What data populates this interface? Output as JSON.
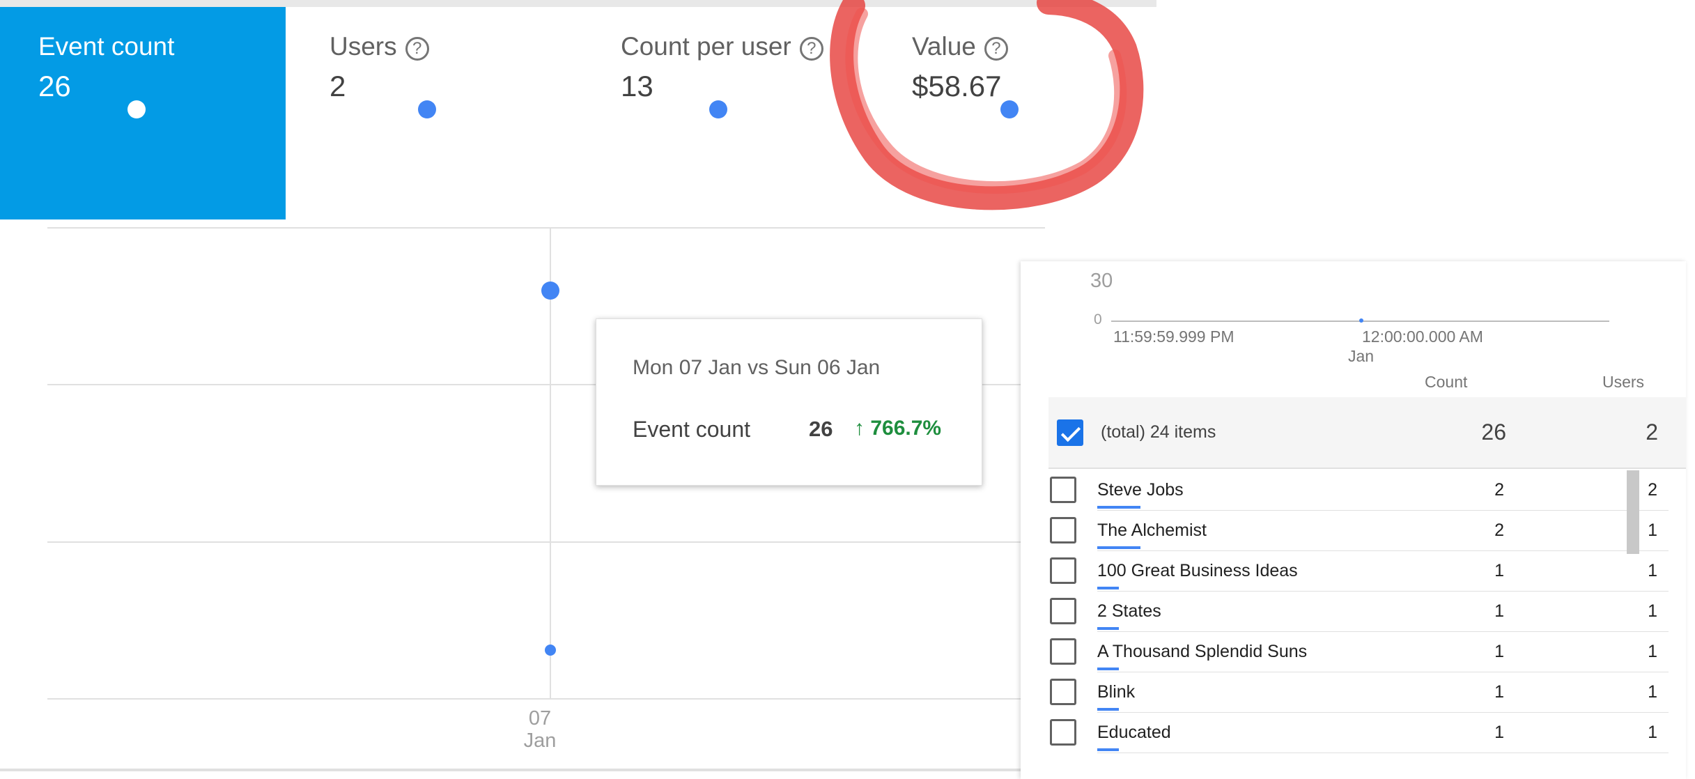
{
  "metrics": [
    {
      "label": "Event count",
      "value": "26",
      "active": true,
      "help": false
    },
    {
      "label": "Users",
      "value": "2",
      "active": false,
      "help": true
    },
    {
      "label": "Count per user",
      "value": "13",
      "active": false,
      "help": true
    },
    {
      "label": "Value",
      "value": "$58.67",
      "active": false,
      "help": true
    }
  ],
  "help_glyph": "?",
  "chart": {
    "x_tick": {
      "day": "07",
      "month": "Jan"
    }
  },
  "tooltip": {
    "date_range": "Mon 07 Jan vs Sun 06 Jan",
    "metric": "Event count",
    "value": "26",
    "delta": "↑ 766.7%"
  },
  "mini_chart": {
    "y_top": "30",
    "y_bottom": "0",
    "x_left": "11:59:59.999 PM",
    "x_right": "12:00:00.000 AM",
    "x_sub": "Jan"
  },
  "table": {
    "headers": {
      "count": "Count",
      "users": "Users"
    },
    "total": {
      "label": "(total) 24 items",
      "count": "26",
      "users": "2"
    },
    "rows": [
      {
        "name": "Steve Jobs",
        "count": "2",
        "users": "2"
      },
      {
        "name": "The Alchemist",
        "count": "2",
        "users": "1"
      },
      {
        "name": "100 Great Business Ideas",
        "count": "1",
        "users": "1"
      },
      {
        "name": "2 States",
        "count": "1",
        "users": "1"
      },
      {
        "name": "A Thousand Splendid Suns",
        "count": "1",
        "users": "1"
      },
      {
        "name": "Blink",
        "count": "1",
        "users": "1"
      },
      {
        "name": "Educated",
        "count": "1",
        "users": "1"
      }
    ]
  },
  "colors": {
    "active_tile": "#039be5",
    "series": "#4285f4",
    "delta_up": "#1e8e3e",
    "annotation": "#e53935"
  }
}
